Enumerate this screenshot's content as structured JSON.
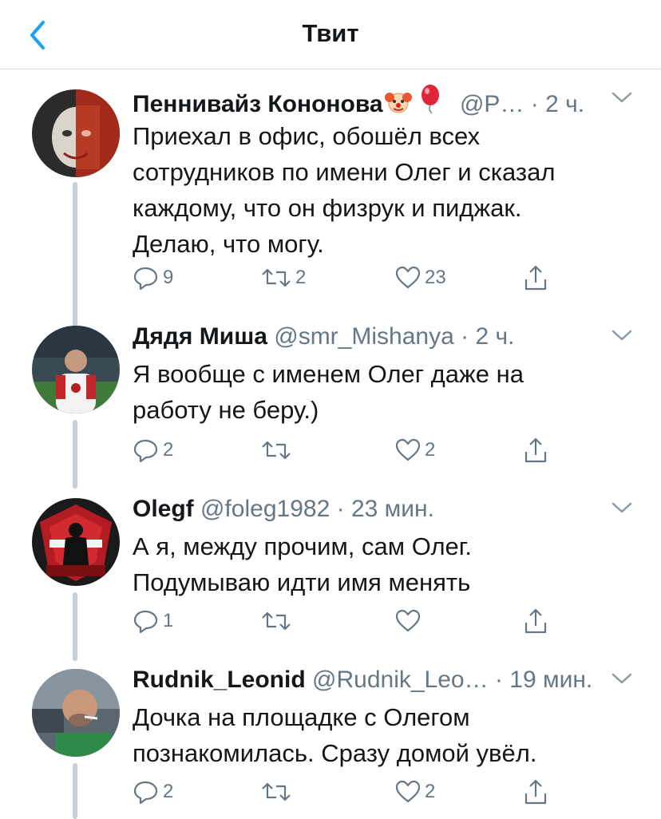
{
  "header": {
    "title": "Твит",
    "back_icon": "chevron-left-icon"
  },
  "colors": {
    "accent": "#1da1f2",
    "secondary_text": "#657786",
    "thread_line": "#c4cfd6"
  },
  "tweets": [
    {
      "name": "Пеннивайз Кононова",
      "name_emoji": [
        "clown-face-emoji",
        "balloon-emoji"
      ],
      "handle": "@P…",
      "dot": "·",
      "time": "2 ч.",
      "lines": [
        "Приехал в офис, обошёл всех",
        "сотрудников по имени Олег и сказал",
        "каждому, что он физрук и пиджак.",
        "Делаю, что могу."
      ],
      "replies": "9",
      "retweets": "2",
      "likes": "23"
    },
    {
      "name": "Дядя Миша",
      "handle": "@smr_Mishanya",
      "dot": "·",
      "time": "2 ч.",
      "lines": [
        "Я вообще с именем Олег даже на",
        "работу не беру.)"
      ],
      "replies": "2",
      "retweets": "",
      "likes": "2"
    },
    {
      "name": "Olegf",
      "handle": "@foleg1982",
      "dot": "·",
      "time": "23 мин.",
      "lines": [
        "А я, между прочим, сам Олег.",
        "Подумываю идти имя менять"
      ],
      "replies": "1",
      "retweets": "",
      "likes": ""
    },
    {
      "name": "Rudnik_Leonid",
      "handle": "@Rudnik_Leo…",
      "dot": "·",
      "time": "19 мин.",
      "lines": [
        "Дочка на площадке с Олегом",
        "познакомилась. Сразу домой увёл."
      ],
      "replies": "2",
      "retweets": "",
      "likes": "2"
    }
  ]
}
